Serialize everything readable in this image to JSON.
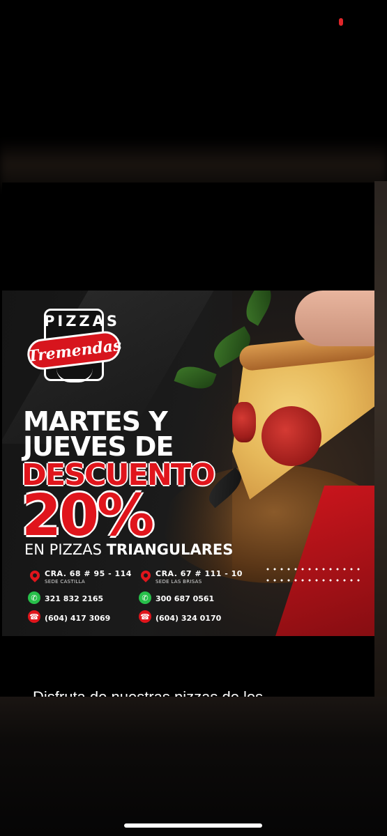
{
  "ad": {
    "logo": {
      "top": "PIZZAS",
      "script": "Tremendas"
    },
    "headline_line1": "MARTES Y",
    "headline_line2": "JUEVES DE",
    "headline_red": "DESCUENTO",
    "percent": "20%",
    "subline_regular": "EN PIZZAS ",
    "subline_bold": "TRIANGULARES",
    "locations": [
      {
        "address": "CRA. 68 # 95 - 114",
        "sede": "SEDE CASTILLA",
        "whatsapp": "321 832 2165",
        "phone": "(604) 417 3069"
      },
      {
        "address": "CRA. 67 # 111 - 10",
        "sede": "SEDE LAS BRISAS",
        "whatsapp": "300 687 0561",
        "phone": "(604) 324 0170"
      }
    ]
  },
  "caption": "Disfruta de nuestras pizzas de los",
  "colors": {
    "brand_red": "#e0151c",
    "whatsapp_green": "#27c04a"
  },
  "icons": [
    "location-pin-icon",
    "whatsapp-icon",
    "phone-icon"
  ]
}
